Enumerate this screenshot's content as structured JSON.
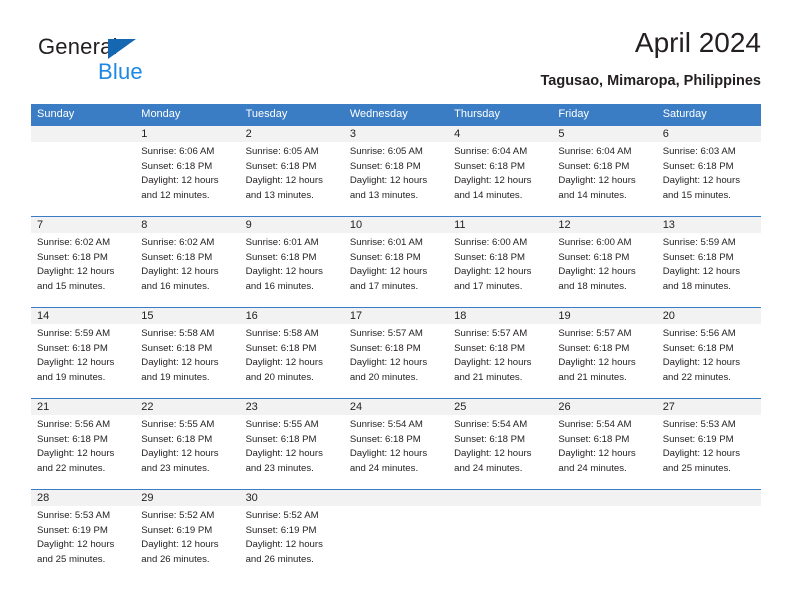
{
  "logo": {
    "word1": "General",
    "word2": "Blue",
    "triangle_color": "#1667b2",
    "blue_color": "#1e88e5"
  },
  "header": {
    "month_title": "April 2024",
    "location": "Tagusao, Mimaropa, Philippines"
  },
  "theme": {
    "header_bar_color": "#3b7dc4",
    "daynum_band_color": "#f2f2f2",
    "text_color": "#231f20"
  },
  "weekdays": [
    "Sunday",
    "Monday",
    "Tuesday",
    "Wednesday",
    "Thursday",
    "Friday",
    "Saturday"
  ],
  "weeks": [
    [
      {
        "day": "",
        "lines": []
      },
      {
        "day": "1",
        "lines": [
          "Sunrise: 6:06 AM",
          "Sunset: 6:18 PM",
          "Daylight: 12 hours",
          "and 12 minutes."
        ]
      },
      {
        "day": "2",
        "lines": [
          "Sunrise: 6:05 AM",
          "Sunset: 6:18 PM",
          "Daylight: 12 hours",
          "and 13 minutes."
        ]
      },
      {
        "day": "3",
        "lines": [
          "Sunrise: 6:05 AM",
          "Sunset: 6:18 PM",
          "Daylight: 12 hours",
          "and 13 minutes."
        ]
      },
      {
        "day": "4",
        "lines": [
          "Sunrise: 6:04 AM",
          "Sunset: 6:18 PM",
          "Daylight: 12 hours",
          "and 14 minutes."
        ]
      },
      {
        "day": "5",
        "lines": [
          "Sunrise: 6:04 AM",
          "Sunset: 6:18 PM",
          "Daylight: 12 hours",
          "and 14 minutes."
        ]
      },
      {
        "day": "6",
        "lines": [
          "Sunrise: 6:03 AM",
          "Sunset: 6:18 PM",
          "Daylight: 12 hours",
          "and 15 minutes."
        ]
      }
    ],
    [
      {
        "day": "7",
        "lines": [
          "Sunrise: 6:02 AM",
          "Sunset: 6:18 PM",
          "Daylight: 12 hours",
          "and 15 minutes."
        ]
      },
      {
        "day": "8",
        "lines": [
          "Sunrise: 6:02 AM",
          "Sunset: 6:18 PM",
          "Daylight: 12 hours",
          "and 16 minutes."
        ]
      },
      {
        "day": "9",
        "lines": [
          "Sunrise: 6:01 AM",
          "Sunset: 6:18 PM",
          "Daylight: 12 hours",
          "and 16 minutes."
        ]
      },
      {
        "day": "10",
        "lines": [
          "Sunrise: 6:01 AM",
          "Sunset: 6:18 PM",
          "Daylight: 12 hours",
          "and 17 minutes."
        ]
      },
      {
        "day": "11",
        "lines": [
          "Sunrise: 6:00 AM",
          "Sunset: 6:18 PM",
          "Daylight: 12 hours",
          "and 17 minutes."
        ]
      },
      {
        "day": "12",
        "lines": [
          "Sunrise: 6:00 AM",
          "Sunset: 6:18 PM",
          "Daylight: 12 hours",
          "and 18 minutes."
        ]
      },
      {
        "day": "13",
        "lines": [
          "Sunrise: 5:59 AM",
          "Sunset: 6:18 PM",
          "Daylight: 12 hours",
          "and 18 minutes."
        ]
      }
    ],
    [
      {
        "day": "14",
        "lines": [
          "Sunrise: 5:59 AM",
          "Sunset: 6:18 PM",
          "Daylight: 12 hours",
          "and 19 minutes."
        ]
      },
      {
        "day": "15",
        "lines": [
          "Sunrise: 5:58 AM",
          "Sunset: 6:18 PM",
          "Daylight: 12 hours",
          "and 19 minutes."
        ]
      },
      {
        "day": "16",
        "lines": [
          "Sunrise: 5:58 AM",
          "Sunset: 6:18 PM",
          "Daylight: 12 hours",
          "and 20 minutes."
        ]
      },
      {
        "day": "17",
        "lines": [
          "Sunrise: 5:57 AM",
          "Sunset: 6:18 PM",
          "Daylight: 12 hours",
          "and 20 minutes."
        ]
      },
      {
        "day": "18",
        "lines": [
          "Sunrise: 5:57 AM",
          "Sunset: 6:18 PM",
          "Daylight: 12 hours",
          "and 21 minutes."
        ]
      },
      {
        "day": "19",
        "lines": [
          "Sunrise: 5:57 AM",
          "Sunset: 6:18 PM",
          "Daylight: 12 hours",
          "and 21 minutes."
        ]
      },
      {
        "day": "20",
        "lines": [
          "Sunrise: 5:56 AM",
          "Sunset: 6:18 PM",
          "Daylight: 12 hours",
          "and 22 minutes."
        ]
      }
    ],
    [
      {
        "day": "21",
        "lines": [
          "Sunrise: 5:56 AM",
          "Sunset: 6:18 PM",
          "Daylight: 12 hours",
          "and 22 minutes."
        ]
      },
      {
        "day": "22",
        "lines": [
          "Sunrise: 5:55 AM",
          "Sunset: 6:18 PM",
          "Daylight: 12 hours",
          "and 23 minutes."
        ]
      },
      {
        "day": "23",
        "lines": [
          "Sunrise: 5:55 AM",
          "Sunset: 6:18 PM",
          "Daylight: 12 hours",
          "and 23 minutes."
        ]
      },
      {
        "day": "24",
        "lines": [
          "Sunrise: 5:54 AM",
          "Sunset: 6:18 PM",
          "Daylight: 12 hours",
          "and 24 minutes."
        ]
      },
      {
        "day": "25",
        "lines": [
          "Sunrise: 5:54 AM",
          "Sunset: 6:18 PM",
          "Daylight: 12 hours",
          "and 24 minutes."
        ]
      },
      {
        "day": "26",
        "lines": [
          "Sunrise: 5:54 AM",
          "Sunset: 6:18 PM",
          "Daylight: 12 hours",
          "and 24 minutes."
        ]
      },
      {
        "day": "27",
        "lines": [
          "Sunrise: 5:53 AM",
          "Sunset: 6:19 PM",
          "Daylight: 12 hours",
          "and 25 minutes."
        ]
      }
    ],
    [
      {
        "day": "28",
        "lines": [
          "Sunrise: 5:53 AM",
          "Sunset: 6:19 PM",
          "Daylight: 12 hours",
          "and 25 minutes."
        ]
      },
      {
        "day": "29",
        "lines": [
          "Sunrise: 5:52 AM",
          "Sunset: 6:19 PM",
          "Daylight: 12 hours",
          "and 26 minutes."
        ]
      },
      {
        "day": "30",
        "lines": [
          "Sunrise: 5:52 AM",
          "Sunset: 6:19 PM",
          "Daylight: 12 hours",
          "and 26 minutes."
        ]
      },
      {
        "day": "",
        "lines": []
      },
      {
        "day": "",
        "lines": []
      },
      {
        "day": "",
        "lines": []
      },
      {
        "day": "",
        "lines": []
      }
    ]
  ]
}
